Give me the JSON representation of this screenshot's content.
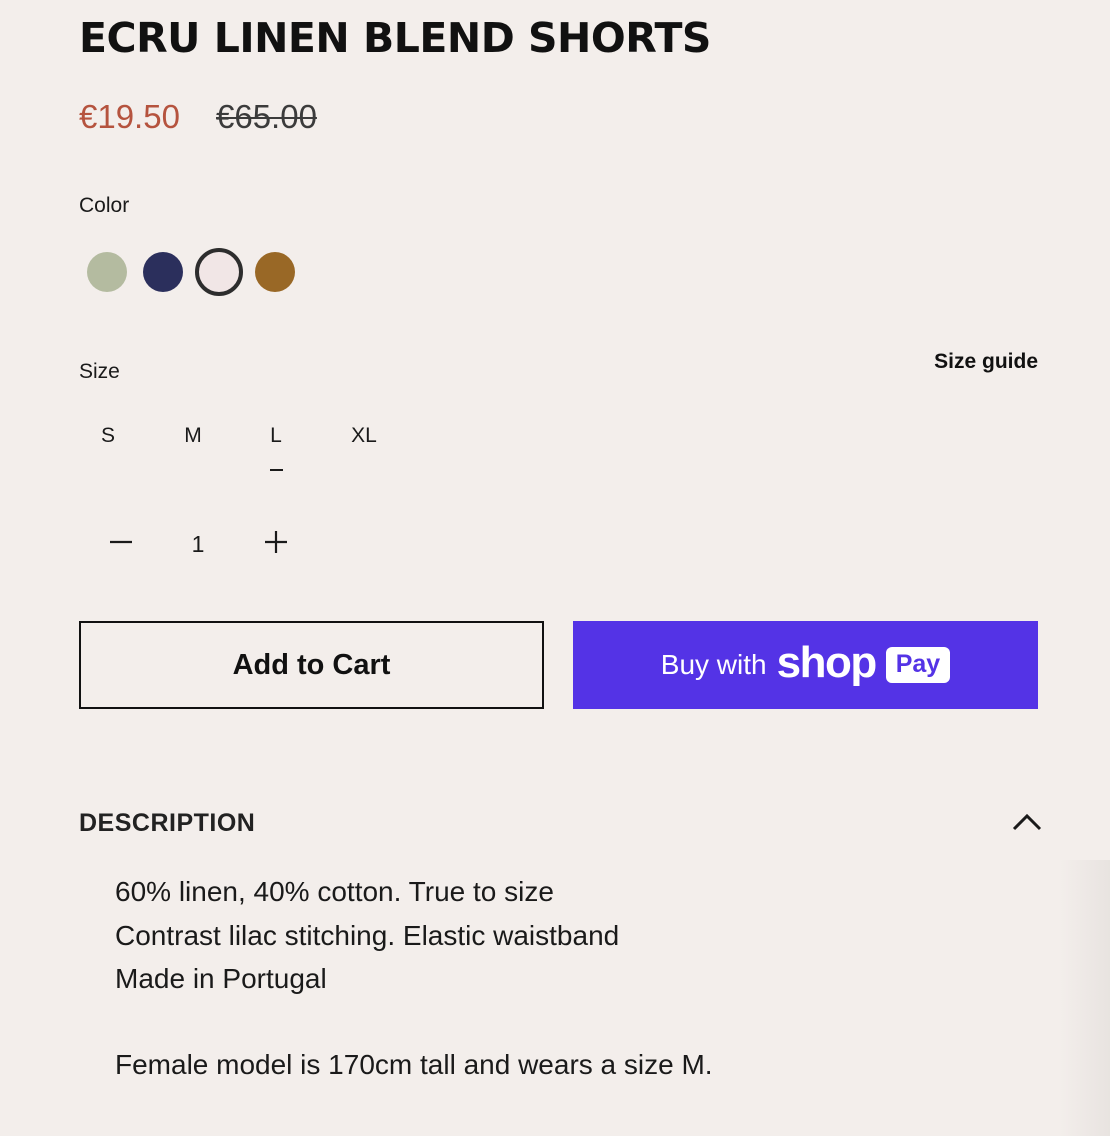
{
  "product": {
    "title": "ECRU LINEN BLEND SHORTS",
    "sale_price": "€19.50",
    "original_price": "€65.00"
  },
  "color": {
    "label": "Color",
    "swatches": [
      {
        "name": "sage",
        "hex": "#b4bba0",
        "selected": false
      },
      {
        "name": "navy",
        "hex": "#2b2f5c",
        "selected": false
      },
      {
        "name": "ecru",
        "hex": "#f1e6e6",
        "selected": true
      },
      {
        "name": "ochre",
        "hex": "#996826",
        "selected": false
      }
    ]
  },
  "size": {
    "label": "Size",
    "guide_label": "Size guide",
    "options": [
      "S",
      "M",
      "L",
      "XL"
    ],
    "selected": "L"
  },
  "quantity": {
    "value": "1",
    "decrement_icon": "minus-icon",
    "increment_icon": "plus-icon"
  },
  "buttons": {
    "add_to_cart": "Add to Cart",
    "shop_pay_prefix": "Buy with",
    "shop_pay_brand": "shop",
    "shop_pay_badge": "Pay"
  },
  "description": {
    "heading": "DESCRIPTION",
    "toggle_icon": "chevron-up-icon",
    "lines": [
      "60% linen, 40% cotton. True to size",
      "Contrast lilac stitching. Elastic waistband",
      "Made in Portugal",
      "Female model is 170cm tall and wears a size M."
    ]
  },
  "colors": {
    "background": "#f3eeeb",
    "sale_price": "#b5533e",
    "shop_pay": "#5433e6"
  }
}
